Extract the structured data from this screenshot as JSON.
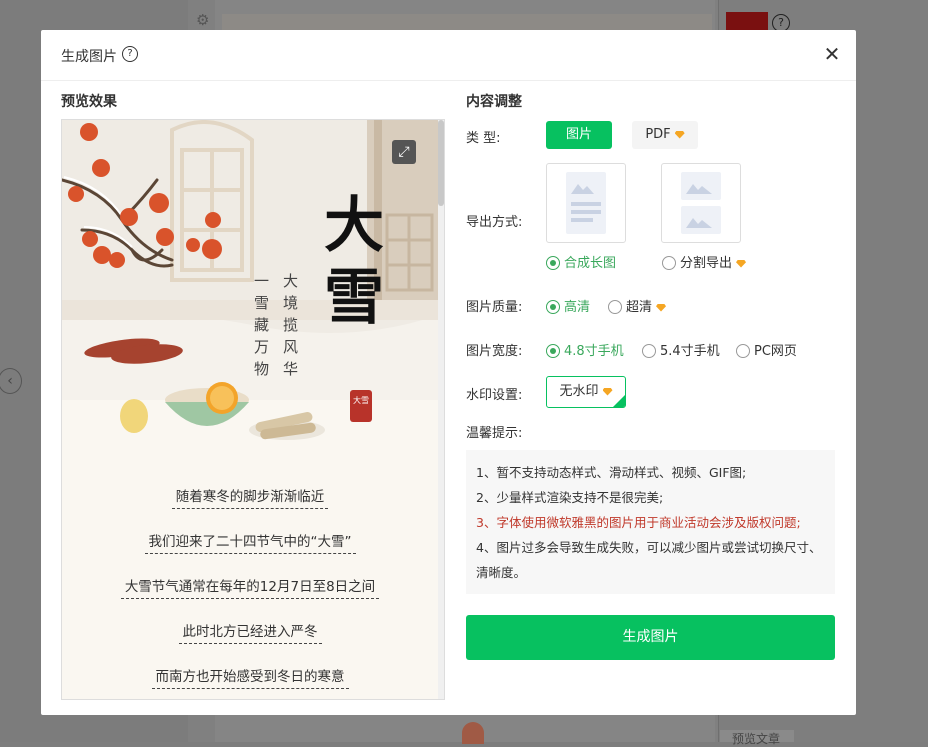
{
  "background": {
    "prev_glyph": "‹",
    "gear_icon": "gear",
    "help_glyph": "?",
    "bottom_label": "预览文章"
  },
  "modal": {
    "title": "生成图片",
    "help_glyph": "?",
    "close_glyph": "✕"
  },
  "preview": {
    "heading": "预览效果",
    "poster": {
      "title_chars": [
        "大",
        "雪"
      ],
      "sub_col1": "大境揽风华",
      "sub_col2": "一雪藏万物",
      "seal": "大雪",
      "lines": [
        "随着寒冬的脚步渐渐临近",
        "我们迎来了二十四节气中的“大雪”",
        "大雪节气通常在每年的12月7日至8日之间",
        "此时北方已经进入严冬",
        "而南方也开始感受到冬日的寒意"
      ]
    }
  },
  "settings": {
    "heading": "内容调整",
    "type_label": "类  型:",
    "type_image": "图片",
    "type_pdf": "PDF",
    "export_label": "导出方式:",
    "export_merge": "合成长图",
    "export_split": "分割导出",
    "quality_label": "图片质量:",
    "quality_hd": "高清",
    "quality_uhd": "超清",
    "width_label": "图片宽度:",
    "width_48": "4.8寸手机",
    "width_54": "5.4寸手机",
    "width_pc": "PC网页",
    "watermark_label": "水印设置:",
    "watermark_none": "无水印",
    "tips_label": "温馨提示:",
    "tips": [
      "1、暂不支持动态样式、滑动样式、视频、GIF图;",
      "2、少量样式渲染支持不是很完美;",
      "3、字体使用微软雅黑的图片用于商业活动会涉及版权问题;",
      "4、图片过多会导致生成失败，可以减少图片或尝试切换尺寸、清晰度。"
    ],
    "generate_button": "生成图片"
  },
  "colors": {
    "accent": "#07c160",
    "radio_on": "#3aa85c",
    "warning": "#c0392b",
    "vip_gem": "#f5a623"
  }
}
